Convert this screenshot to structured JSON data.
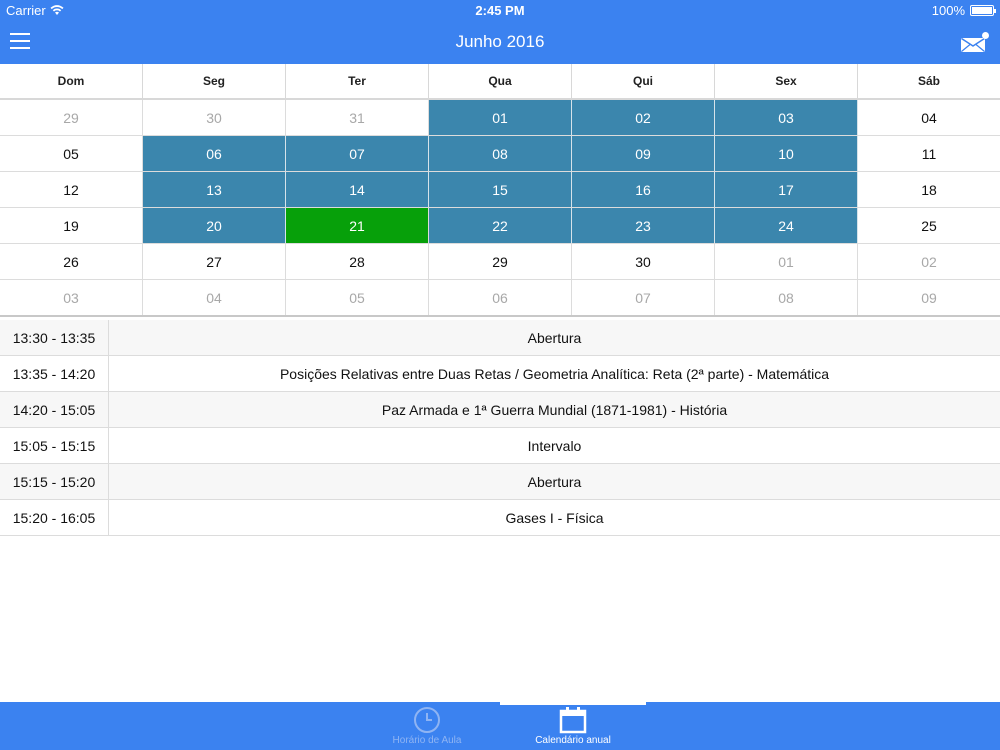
{
  "status_bar": {
    "carrier": "Carrier",
    "time": "2:45 PM",
    "battery": "100%",
    "battery_level": 1.0
  },
  "nav": {
    "title": "Junho 2016",
    "menu_icon": "hamburger-menu-icon",
    "mail_icon": "mail-notification-icon"
  },
  "calendar": {
    "weekdays": [
      "Dom",
      "Seg",
      "Ter",
      "Qua",
      "Qui",
      "Sex",
      "Sáb"
    ],
    "weeks": [
      [
        {
          "d": "29",
          "s": "other"
        },
        {
          "d": "30",
          "s": "other"
        },
        {
          "d": "31",
          "s": "other"
        },
        {
          "d": "01",
          "s": "school"
        },
        {
          "d": "02",
          "s": "school"
        },
        {
          "d": "03",
          "s": "school"
        },
        {
          "d": "04",
          "s": "normal"
        }
      ],
      [
        {
          "d": "05",
          "s": "normal"
        },
        {
          "d": "06",
          "s": "school"
        },
        {
          "d": "07",
          "s": "school"
        },
        {
          "d": "08",
          "s": "school"
        },
        {
          "d": "09",
          "s": "school"
        },
        {
          "d": "10",
          "s": "school"
        },
        {
          "d": "11",
          "s": "normal"
        }
      ],
      [
        {
          "d": "12",
          "s": "normal"
        },
        {
          "d": "13",
          "s": "school"
        },
        {
          "d": "14",
          "s": "school"
        },
        {
          "d": "15",
          "s": "school"
        },
        {
          "d": "16",
          "s": "school"
        },
        {
          "d": "17",
          "s": "school"
        },
        {
          "d": "18",
          "s": "normal"
        }
      ],
      [
        {
          "d": "19",
          "s": "normal"
        },
        {
          "d": "20",
          "s": "school"
        },
        {
          "d": "21",
          "s": "today"
        },
        {
          "d": "22",
          "s": "school"
        },
        {
          "d": "23",
          "s": "school"
        },
        {
          "d": "24",
          "s": "school"
        },
        {
          "d": "25",
          "s": "normal"
        }
      ],
      [
        {
          "d": "26",
          "s": "normal"
        },
        {
          "d": "27",
          "s": "normal"
        },
        {
          "d": "28",
          "s": "normal"
        },
        {
          "d": "29",
          "s": "normal"
        },
        {
          "d": "30",
          "s": "normal"
        },
        {
          "d": "01",
          "s": "other"
        },
        {
          "d": "02",
          "s": "other"
        }
      ],
      [
        {
          "d": "03",
          "s": "other"
        },
        {
          "d": "04",
          "s": "other"
        },
        {
          "d": "05",
          "s": "other"
        },
        {
          "d": "06",
          "s": "other"
        },
        {
          "d": "07",
          "s": "other"
        },
        {
          "d": "08",
          "s": "other"
        },
        {
          "d": "09",
          "s": "other"
        }
      ]
    ],
    "colors": {
      "school_day": "#3b86ad",
      "selected_day": "#07a00a",
      "other_month_text": "#a8a8a8"
    }
  },
  "schedule": [
    {
      "time": "13:30 - 13:35",
      "subject": "Abertura"
    },
    {
      "time": "13:35 - 14:20",
      "subject": "Posições Relativas entre Duas Retas / Geometria Analítica: Reta (2ª parte) - Matemática"
    },
    {
      "time": "14:20 - 15:05",
      "subject": "Paz Armada e 1ª Guerra Mundial (1871-1981) - História"
    },
    {
      "time": "15:05 - 15:15",
      "subject": "Intervalo"
    },
    {
      "time": "15:15 - 15:20",
      "subject": "Abertura"
    },
    {
      "time": "15:20 - 16:05",
      "subject": "Gases I - Física"
    }
  ],
  "tabs": {
    "schedule": {
      "label": "Horário de Aula",
      "icon": "clock-icon"
    },
    "calendar": {
      "label": "Calendário anual",
      "icon": "calendar-icon"
    }
  },
  "theme": {
    "primary": "#3b82f0"
  }
}
